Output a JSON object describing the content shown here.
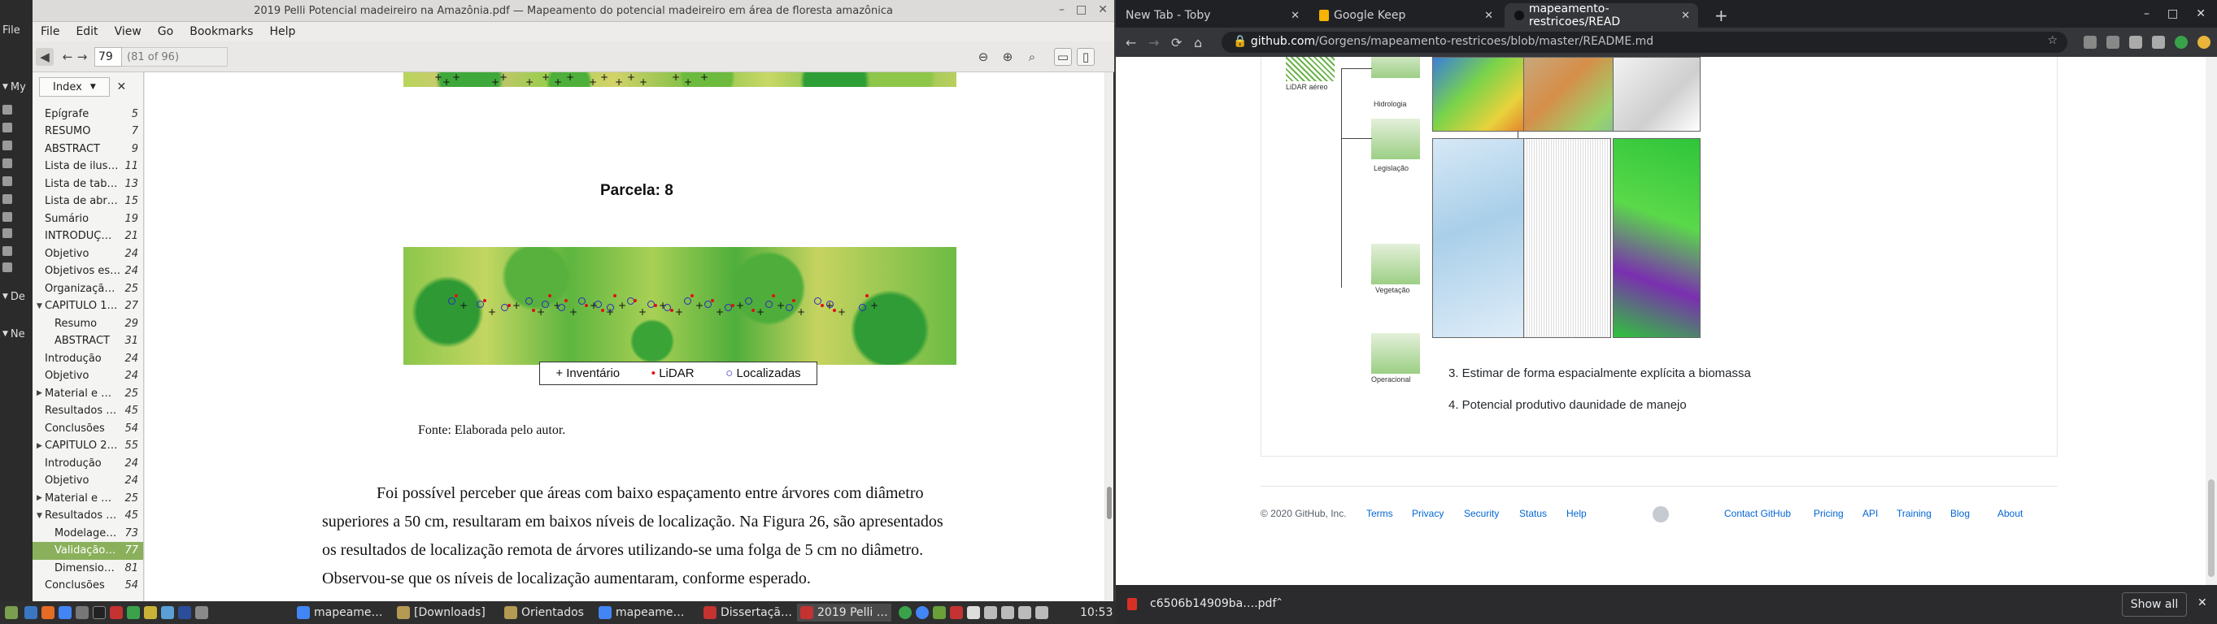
{
  "desktop": {
    "items": [
      "File",
      "My",
      "De",
      "Ne"
    ]
  },
  "pdf": {
    "title": "2019 Pelli Potencial madeireiro na Amazônia.pdf — Mapeamento do potencial madeireiro em área de floresta amazônica",
    "menu": [
      "File",
      "Edit",
      "View",
      "Go",
      "Bookmarks",
      "Help"
    ],
    "page_input": "79",
    "page_of": "(81 of 96)",
    "sidebar_mode": "Index",
    "toc": [
      {
        "label": "Epígrafe",
        "page": "5",
        "arrow": ""
      },
      {
        "label": "RESUMO",
        "page": "7",
        "arrow": ""
      },
      {
        "label": "ABSTRACT",
        "page": "9",
        "arrow": ""
      },
      {
        "label": "Lista de ilus…",
        "page": "11",
        "arrow": ""
      },
      {
        "label": "Lista de tab…",
        "page": "13",
        "arrow": ""
      },
      {
        "label": "Lista de abr…",
        "page": "15",
        "arrow": ""
      },
      {
        "label": "Sumário",
        "page": "19",
        "arrow": ""
      },
      {
        "label": "INTRODUÇ…",
        "page": "21",
        "arrow": ""
      },
      {
        "label": "Objetivo",
        "page": "24",
        "arrow": ""
      },
      {
        "label": "Objetivos es…",
        "page": "24",
        "arrow": ""
      },
      {
        "label": "Organizaçã…",
        "page": "25",
        "arrow": ""
      },
      {
        "label": "CAPÍTULO 1…",
        "page": "27",
        "arrow": "▼"
      },
      {
        "label": "Resumo",
        "page": "29",
        "arrow": "",
        "indent": true
      },
      {
        "label": "ABSTRACT",
        "page": "31",
        "arrow": "",
        "indent": true
      },
      {
        "label": "Introdução",
        "page": "24",
        "arrow": ""
      },
      {
        "label": "Objetivo",
        "page": "24",
        "arrow": ""
      },
      {
        "label": "Material e …",
        "page": "25",
        "arrow": "▶"
      },
      {
        "label": "Resultados …",
        "page": "45",
        "arrow": ""
      },
      {
        "label": "Conclusões",
        "page": "54",
        "arrow": ""
      },
      {
        "label": "CAPÍTULO 2…",
        "page": "55",
        "arrow": "▶"
      },
      {
        "label": "Introdução",
        "page": "24",
        "arrow": ""
      },
      {
        "label": "Objetivo",
        "page": "24",
        "arrow": ""
      },
      {
        "label": "Material e …",
        "page": "25",
        "arrow": "▶"
      },
      {
        "label": "Resultados …",
        "page": "45",
        "arrow": "▼"
      },
      {
        "label": "Modelage…",
        "page": "73",
        "arrow": "",
        "indent": true
      },
      {
        "label": "Validação…",
        "page": "77",
        "arrow": "",
        "indent": true,
        "selected": true
      },
      {
        "label": "Dimensio…",
        "page": "81",
        "arrow": "",
        "indent": true
      },
      {
        "label": "Conclusões",
        "page": "54",
        "arrow": ""
      }
    ],
    "figure_caption": "Parcela:  8",
    "legend": {
      "inventario": "Inventário",
      "lidar": "LiDAR",
      "localizadas": "Localizadas"
    },
    "source": "Fonte: Elaborada pelo autor.",
    "paragraph": [
      "Foi possível perceber que áreas com baixo espaçamento entre árvores com diâmetro",
      "superiores a 50 cm, resultaram em baixos níveis de localização. Na Figura 26, são apresentados",
      "os resultados de localização remota de árvores utilizando-se uma folga de 5 cm no diâmetro.",
      "Observou-se que os níveis de localização aumentaram, conforme esperado."
    ]
  },
  "browser": {
    "tabs": [
      {
        "title": "New Tab - Toby"
      },
      {
        "title": "Google Keep"
      },
      {
        "title": "mapeamento-restricoes/READ"
      }
    ],
    "url_host": "github.com",
    "url_path": "/Gorgens/mapeamento-restricoes/blob/master/README.md",
    "diagram_labels": {
      "source": "LiDAR aéreo",
      "l1": "Hidrologia",
      "l2": "Legislação",
      "l3": "Vegetação",
      "l4": "Operacional"
    },
    "list_items": [
      "3. Estimar de forma espacialmente explícita a biomassa",
      "4. Potencial produtivo daunidade de manejo"
    ],
    "footer": {
      "copyright": "© 2020 GitHub, Inc.",
      "left_links": [
        "Terms",
        "Privacy",
        "Security",
        "Status",
        "Help"
      ],
      "right_links": [
        "Contact GitHub",
        "Pricing",
        "API",
        "Training",
        "Blog",
        "About"
      ]
    },
    "download": {
      "file": "c6506b14909ba….pdf",
      "show_all": "Show all"
    }
  },
  "taskbar": {
    "items": [
      "mapeame…",
      "[Downloads]",
      "Orientados",
      "mapeame…",
      "Dissertaçã…",
      "2019 Pelli …"
    ],
    "clock": "10:53"
  }
}
